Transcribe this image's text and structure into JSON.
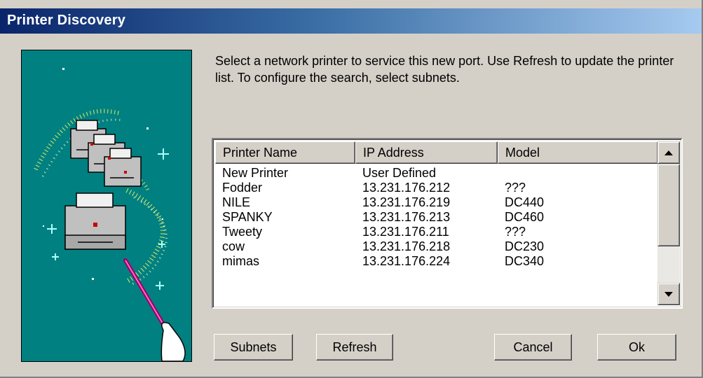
{
  "window": {
    "title": "Printer Discovery"
  },
  "instructions": "Select a network printer to service this new port. Use Refresh to update the printer list. To configure the search, select subnets.",
  "printer_list": {
    "columns": [
      "Printer Name",
      "IP Address",
      "Model"
    ],
    "rows": [
      [
        "New Printer",
        "User Defined",
        ""
      ],
      [
        "Fodder",
        "13.231.176.212",
        "???"
      ],
      [
        "NILE",
        "13.231.176.219",
        "DC440"
      ],
      [
        "SPANKY",
        "13.231.176.213",
        "DC460"
      ],
      [
        "Tweety",
        "13.231.176.211",
        "???"
      ],
      [
        "cow",
        "13.231.176.218",
        "DC230"
      ],
      [
        "mimas",
        "13.231.176.224",
        "DC340"
      ]
    ]
  },
  "buttons": {
    "subnets": "Subnets",
    "refresh": "Refresh",
    "cancel": "Cancel",
    "ok": "Ok"
  },
  "colors": {
    "title_gradient_start": "#0a246a",
    "title_gradient_end": "#a6caf0",
    "art_background": "#008080",
    "dialog_face": "#d4d0c8"
  },
  "icons": {
    "art": "wizard-printer-illustration",
    "scroll_up": "scroll-up-arrow-icon",
    "scroll_down": "scroll-down-arrow-icon"
  }
}
